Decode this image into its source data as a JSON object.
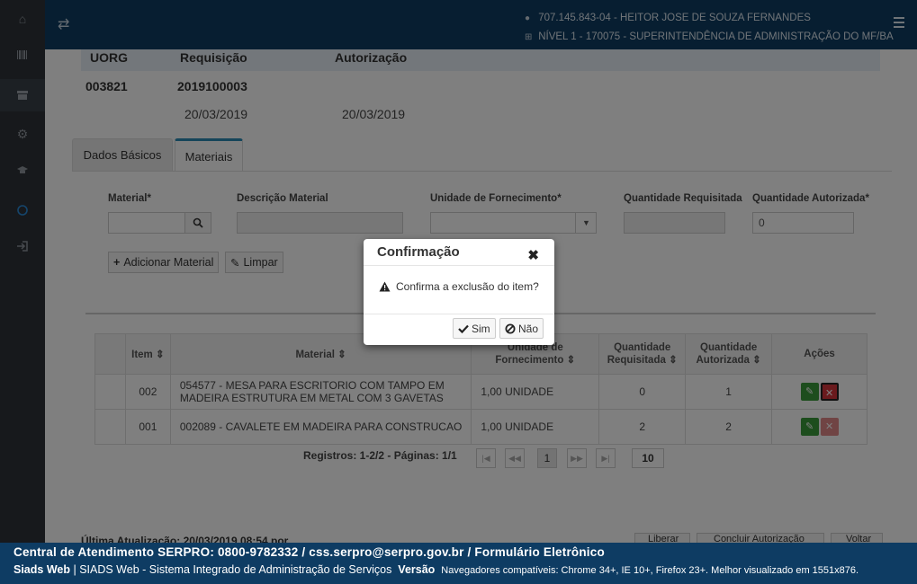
{
  "user": {
    "cpf_name": "707.145.843-04 - HEITOR JOSE DE SOUZA FERNANDES",
    "unit": "NÍVEL 1 - 170075 - SUPERINTENDÊNCIA DE ADMINISTRAÇÃO DO MF/BA"
  },
  "header": {
    "uorg_label": "UORG",
    "req_label": "Requisição",
    "aut_label": "Autorização",
    "uorg_value": "003821",
    "req_value": "2019100003",
    "req_date": "20/03/2019",
    "aut_date": "20/03/2019"
  },
  "tabs": [
    "Dados Básicos",
    "Materiais"
  ],
  "form": {
    "material_label": "Material*",
    "descricao_label": "Descrição Material",
    "unidade_label": "Unidade de Fornecimento*",
    "qtd_req_label": "Quantidade Requisitada",
    "qtd_aut_label": "Quantidade Autorizada*",
    "qtd_aut_value": "0",
    "add_label": "Adicionar Material",
    "clear_label": "Limpar"
  },
  "table": {
    "headers": [
      "Item",
      "Material",
      "Unidade de Fornecimento",
      "Quantidade Requisitada",
      "Quantidade Autorizada",
      "Ações"
    ],
    "rows": [
      {
        "item": "002",
        "material": "054577 - MESA PARA ESCRITORIO COM TAMPO EM MADEIRA ESTRUTURA EM METAL COM 3 GAVETAS",
        "unidade": "1,00 UNIDADE",
        "qtd_req": "0",
        "qtd_aut": "1"
      },
      {
        "item": "001",
        "material": "002089 - CAVALETE EM MADEIRA PARA CONSTRUCAO",
        "unidade": "1,00 UNIDADE",
        "qtd_req": "2",
        "qtd_aut": "2"
      }
    ],
    "registros": "Registros: 1-2/2 - Páginas: 1/1",
    "page": "1",
    "page_size": "10"
  },
  "last_update": "Última Atualização: 20/03/2019 08:54 por",
  "bottom_buttons": [
    "Liberar",
    "Concluir Autorização",
    "Voltar"
  ],
  "modal": {
    "title": "Confirmação",
    "message": "Confirma a exclusão do item?",
    "yes": "Sim",
    "no": "Não"
  },
  "footer": {
    "line1": "Central de Atendimento SERPRO: 0800-9782332 / css.serpro@serpro.gov.br / Formulário Eletrônico",
    "app": "Siads Web",
    "app_desc": "SIADS Web - Sistema Integrado de Administração de Serviços",
    "versao": "Versão",
    "browsers": "Navegadores compatíveis: Chrome 34+, IE 10+, Firefox 23+. Melhor visualizado em 1551x876."
  }
}
